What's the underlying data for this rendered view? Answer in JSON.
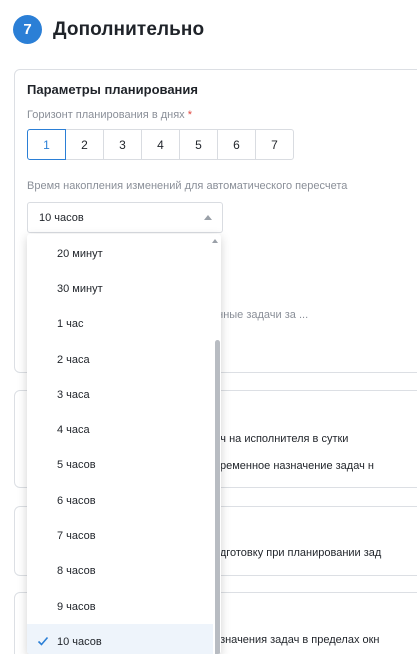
{
  "step": {
    "number": "7",
    "title": "Дополнительно"
  },
  "planning": {
    "title": "Параметры планирования",
    "horizon_label": "Горизонт планирования в днях",
    "required_mark": "*",
    "days": [
      "1",
      "2",
      "3",
      "4",
      "5",
      "6",
      "7"
    ],
    "selected_day": "1",
    "recalc_label": "Время накопления изменений для автоматического пересчета",
    "recalc_value": "10 часов"
  },
  "background_text": {
    "line1": "енные задачи за ...",
    "line2": "дач на исполнителя в сутки",
    "line3": "овременное назначение задач н",
    "line4": "подготовку при планировании зад",
    "line5": "назначения задач в пределах окн"
  },
  "dropdown": {
    "options": [
      "20 минут",
      "30 минут",
      "1 час",
      "2 часа",
      "3 часа",
      "4 часа",
      "5 часов",
      "6 часов",
      "7 часов",
      "8 часов",
      "9 часов",
      "10 часов"
    ],
    "selected": "10 часов"
  },
  "colors": {
    "accent": "#2b7fd6",
    "required": "#e0463f",
    "muted_text": "#8a8f98",
    "selected_bg": "#eef4fb"
  }
}
